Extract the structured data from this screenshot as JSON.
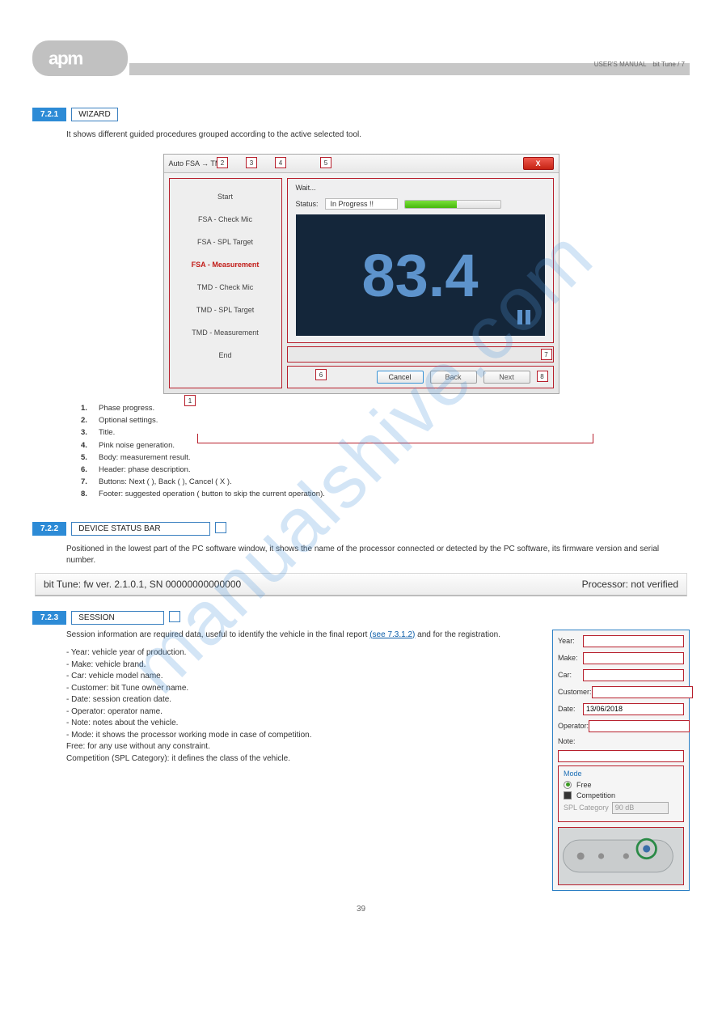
{
  "watermark": "manualshive.com",
  "header": {
    "logo_text": "apm",
    "caption_left": "USER'S MANUAL",
    "caption_right": "bit Tune / 7"
  },
  "sec_721": {
    "num": "7.2.1",
    "title": "WIZARD",
    "body": "It shows different guided procedures grouped according to the active selected tool."
  },
  "dialog": {
    "title": "Auto FSA → TMD",
    "close": "X",
    "sidebar": [
      "Start",
      "FSA - Check Mic",
      "FSA - SPL Target",
      "FSA - Measurement",
      "TMD - Check Mic",
      "TMD - SPL Target",
      "TMD - Measurement",
      "End"
    ],
    "wait": "Wait...",
    "status_label": "Status:",
    "status_value": "In Progress !!",
    "spl": "83.4",
    "middle": "",
    "buttons": {
      "cancel": "Cancel",
      "back": "Back",
      "next": "Next"
    }
  },
  "callouts": {
    "c1": "1",
    "c2": "2",
    "c3": "3",
    "c4": "4",
    "c5": "5",
    "c6": "6",
    "c7": "7",
    "c8": "8"
  },
  "legend": {
    "l1": {
      "n": "1.",
      "t": "Phase progress."
    },
    "l2": {
      "n": "2.",
      "t": "Optional settings."
    },
    "l3": {
      "n": "3.",
      "t": "Title."
    },
    "l4": {
      "n": "4.",
      "t": "Pink noise generation."
    },
    "l5": {
      "n": "5.",
      "t": "Body: measurement result."
    },
    "l6": {
      "n": "6.",
      "t": "Header: phase description."
    },
    "l7": {
      "n": "7.",
      "t": "Buttons: Next (  ), Back (  ), Cancel ( X )."
    },
    "l8": {
      "n": "8.",
      "t": "Footer: suggested operation (   button to skip the current operation)."
    }
  },
  "sec_722": {
    "num": "7.2.2",
    "title": "DEVICE STATUS BAR",
    "body": "Positioned in the lowest part of the PC software window, it shows the name of the processor connected or detected by the PC software, its firmware version and serial number."
  },
  "statusbar": {
    "left": "bit Tune: fw ver. 2.1.0.1, SN 00000000000000",
    "right": "Processor: not verified"
  },
  "sec_723": {
    "num": "7.2.3",
    "title": "SESSION",
    "body_intro": "Session information are required data, useful to identify the vehicle in the final report ",
    "body_link_text": "(see 7.3.1.2)",
    "body_after_link": " and for the registration.",
    "fields": {
      "year": "Year:",
      "make": "Make:",
      "car": "Car:",
      "customer": "Customer:",
      "date": "Date:",
      "date_val": "13/06/2018",
      "operator": "Operator:",
      "note": "Note:"
    },
    "mode": {
      "title": "Mode",
      "free": "Free",
      "comp": "Competition",
      "spl_cat": "SPL Category",
      "spl_val": "90 dB"
    },
    "bullets": {
      "year": "- Year: vehicle year of production.",
      "make": "- Make: vehicle brand.",
      "car": "- Car: vehicle model name.",
      "customer": "- Customer: bit Tune owner name.",
      "date": "- Date: session creation date.",
      "operator": "- Operator: operator name.",
      "note": "- Note: notes about the vehicle.",
      "mode": "- Mode: it shows the processor working mode in case of competition.",
      "free": "  Free: for any use without any constraint.",
      "competition": "  Competition (SPL Category): it defines the class of the vehicle."
    }
  },
  "page_number": "39"
}
